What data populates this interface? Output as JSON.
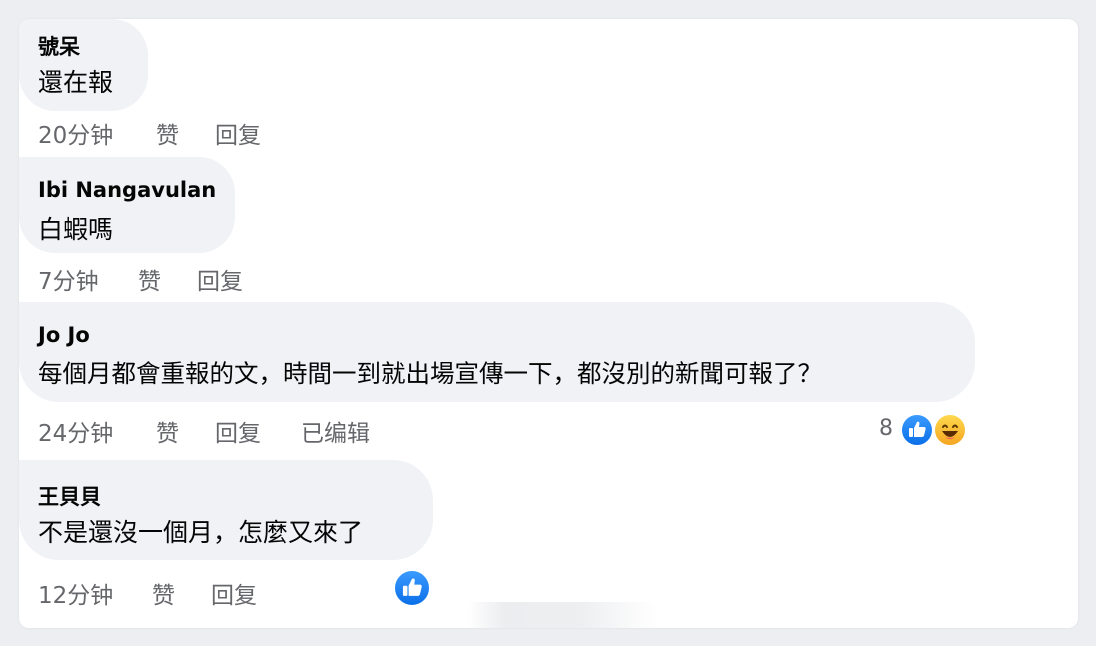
{
  "comments": [
    {
      "author": "號呆",
      "text": "還在報",
      "time": "20分钟",
      "like_label": "赞",
      "reply_label": "回复"
    },
    {
      "author": "Ibi Nangavulan",
      "text": "白蝦嗎",
      "time": "7分钟",
      "like_label": "赞",
      "reply_label": "回复"
    },
    {
      "author": "Jo Jo",
      "text": "每個月都會重報的文，時間一到就出場宣傳一下，都沒別的新聞可報了？",
      "time": "24分钟",
      "like_label": "赞",
      "reply_label": "回复",
      "edited_label": "已编辑",
      "reaction_count": "8"
    },
    {
      "author": "王貝貝",
      "text": "不是還沒一個月，怎麼又來了",
      "time": "12分钟",
      "like_label": "赞",
      "reply_label": "回复"
    }
  ],
  "reaction_icons": [
    "like-icon",
    "haha-icon"
  ],
  "colors": {
    "bubble": "#f0f2f5",
    "meta_text": "#65676b",
    "like_blue": "#1877f2",
    "haha_yellow": "#f7b928"
  }
}
